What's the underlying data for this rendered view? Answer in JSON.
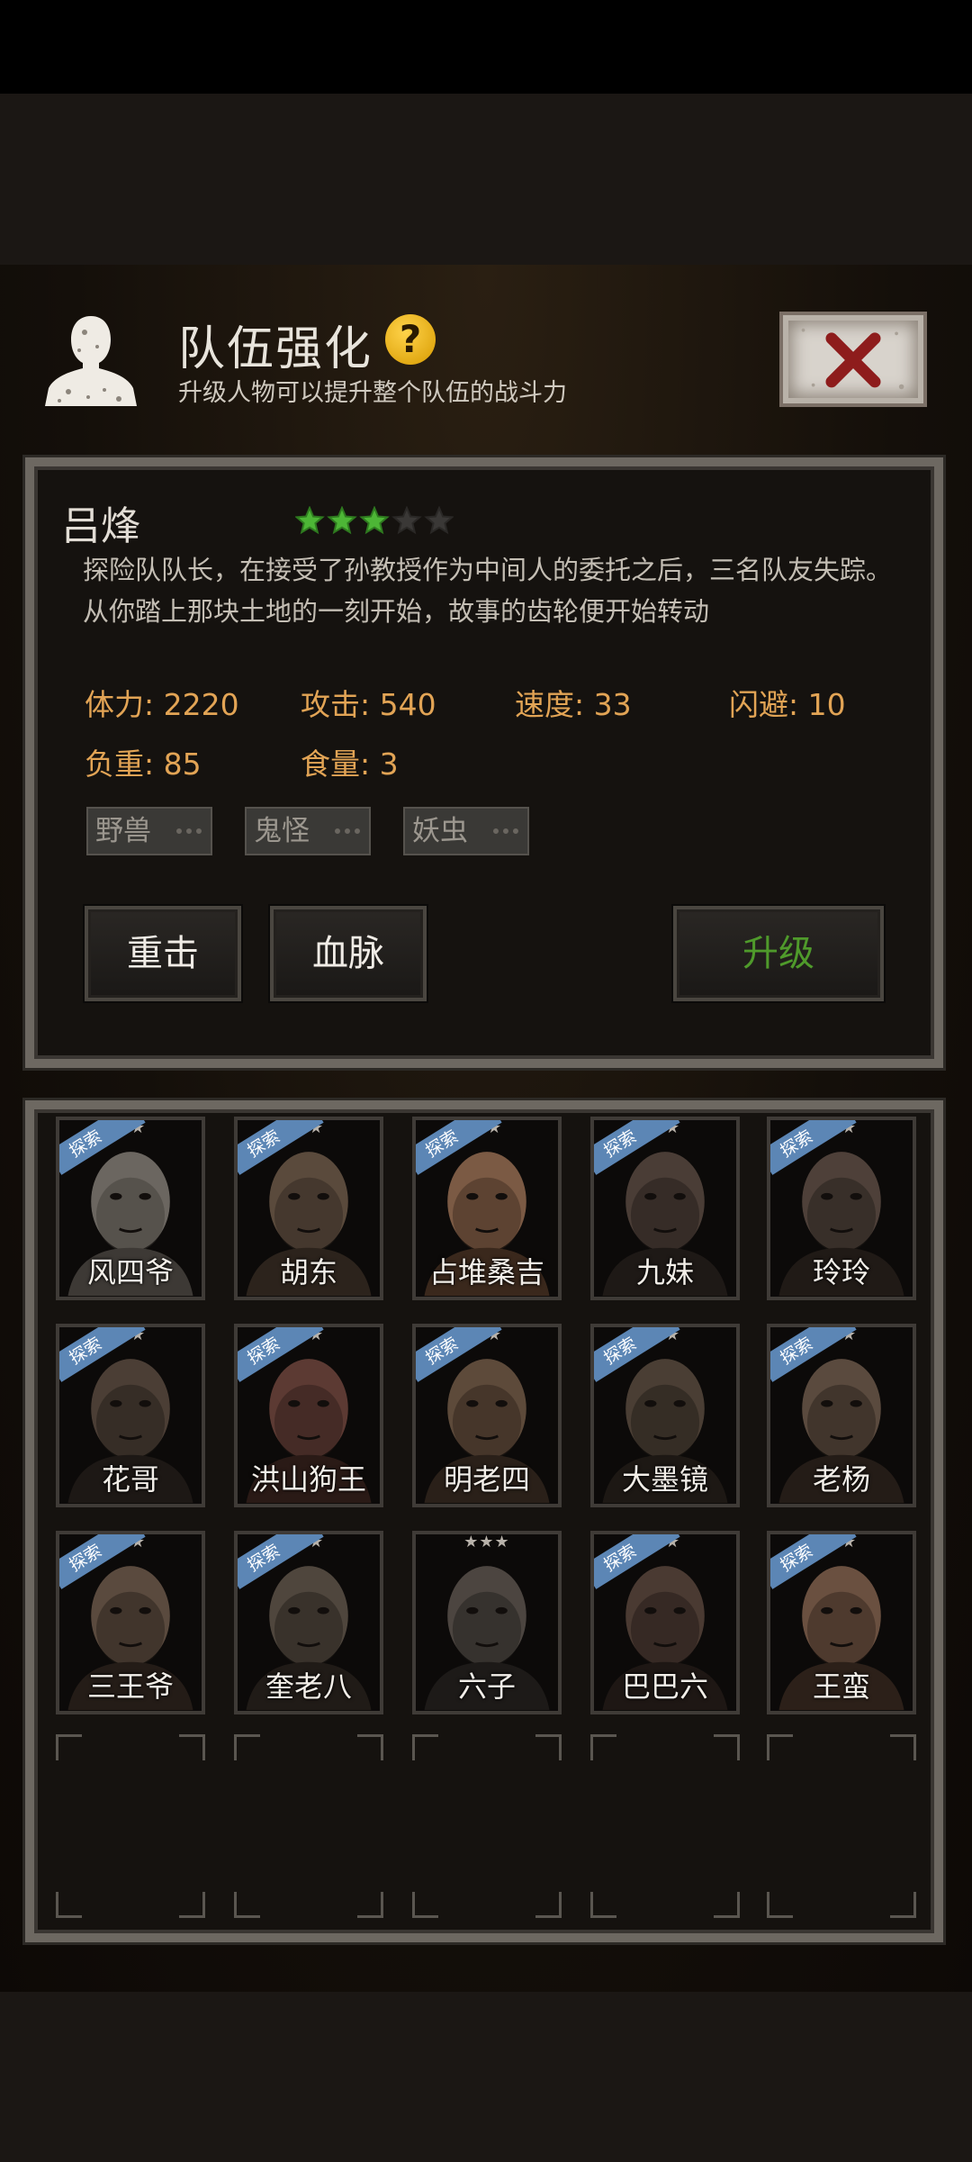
{
  "header": {
    "title": "队伍强化",
    "help_icon": "?",
    "subtitle": "升级人物可以提升整个队伍的战斗力"
  },
  "character": {
    "name": "吕烽",
    "stars_filled": 3,
    "stars_total": 5,
    "description": "探险队队长，在接受了孙教授作为中间人的委托之后，三名队友失踪。从你踏上那块土地的一刻开始，故事的齿轮便开始转动",
    "stats": {
      "hp": "体力: 2220",
      "attack": "攻击: 540",
      "speed": "速度: 33",
      "dodge": "闪避: 10",
      "load": "负重: 85",
      "food": "食量: 3"
    },
    "tags": [
      "野兽",
      "鬼怪",
      "妖虫"
    ]
  },
  "buttons": {
    "skill1": "重击",
    "skill2": "血脉",
    "upgrade": "升级"
  },
  "roster": [
    {
      "name": "风四爷",
      "badge": "探索",
      "stars": "★★"
    },
    {
      "name": "胡东",
      "badge": "探索",
      "stars": "★★"
    },
    {
      "name": "占堆桑吉",
      "badge": "探索",
      "stars": "★★"
    },
    {
      "name": "九妹",
      "badge": "探索",
      "stars": "★★"
    },
    {
      "name": "玲玲",
      "badge": "探索",
      "stars": "★★"
    },
    {
      "name": "花哥",
      "badge": "探索",
      "stars": "★★"
    },
    {
      "name": "洪山狗王",
      "badge": "探索",
      "stars": "★★"
    },
    {
      "name": "明老四",
      "badge": "探索",
      "stars": "★★"
    },
    {
      "name": "大墨镜",
      "badge": "探索",
      "stars": "★★"
    },
    {
      "name": "老杨",
      "badge": "探索",
      "stars": "★★"
    },
    {
      "name": "三王爷",
      "badge": "探索",
      "stars": "★★"
    },
    {
      "name": "奎老八",
      "badge": "探索",
      "stars": "★★"
    },
    {
      "name": "六子",
      "badge": "",
      "stars": "★★★"
    },
    {
      "name": "巴巴六",
      "badge": "探索",
      "stars": "★★"
    },
    {
      "name": "王蛮",
      "badge": "探索",
      "stars": "★★"
    }
  ],
  "colors": {
    "stat_orange": "#e2a455",
    "upgrade_green": "#4f9a2b",
    "star_green": "#4db636",
    "badge_blue": "#5c86b5"
  }
}
